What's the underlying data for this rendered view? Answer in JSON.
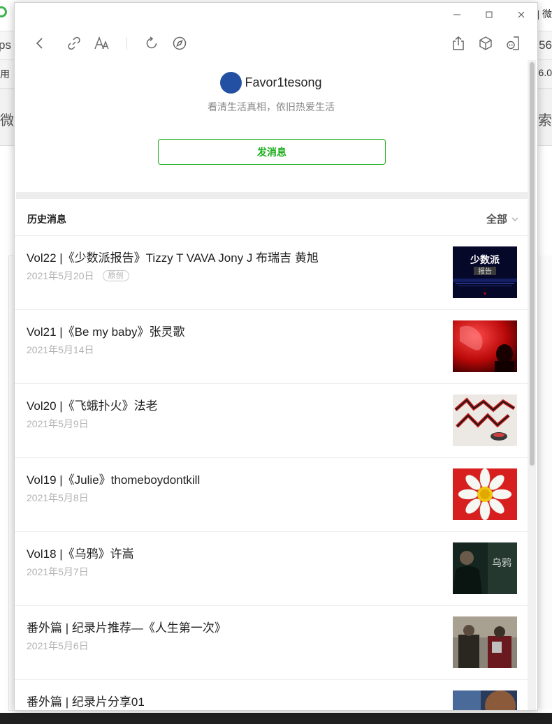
{
  "background": {
    "title_right": "| 微",
    "url_left": "ps",
    "url_right": "56",
    "bookmark_left": "用",
    "bookmark_right": "6.0",
    "search_left": "微",
    "search_right": "索"
  },
  "window": {
    "minimize": "minimize-icon",
    "maximize": "maximize-icon",
    "close": "close-icon"
  },
  "toolbar": {
    "icons": [
      "back-icon",
      "link-icon",
      "font-size-icon",
      "refresh-icon",
      "compass-icon",
      "share-icon",
      "cube-icon",
      "mini-program-icon"
    ]
  },
  "profile": {
    "name": "Favor1tesong",
    "description": "看清生活真相，依旧热爱生活",
    "send_message_label": "发消息",
    "accent_color": "#1aad19",
    "avatar_color": "#2350a3"
  },
  "history": {
    "title": "历史消息",
    "filter_label": "全部",
    "articles": [
      {
        "title": "Vol22 |《少数派报告》Tizzy T VAVA Jony J 布瑞吉 黄旭",
        "date": "2021年5月20日",
        "badge": "原创",
        "thumb_text": "少数派报告"
      },
      {
        "title": "Vol21 |《Be my baby》张灵歌",
        "date": "2021年5月14日",
        "badge": ""
      },
      {
        "title": "Vol20 |《飞蛾扑火》法老",
        "date": "2021年5月9日",
        "badge": ""
      },
      {
        "title": "Vol19 |《Julie》thomeboydontkill",
        "date": "2021年5月8日",
        "badge": ""
      },
      {
        "title": "Vol18 |《乌鸦》许嵩",
        "date": "2021年5月7日",
        "badge": "",
        "thumb_text": "乌鸦"
      },
      {
        "title": "番外篇 | 纪录片推荐—《人生第一次》",
        "date": "2021年5月6日",
        "badge": ""
      },
      {
        "title": "番外篇 | 纪录片分享01",
        "date": "",
        "badge": ""
      }
    ]
  }
}
